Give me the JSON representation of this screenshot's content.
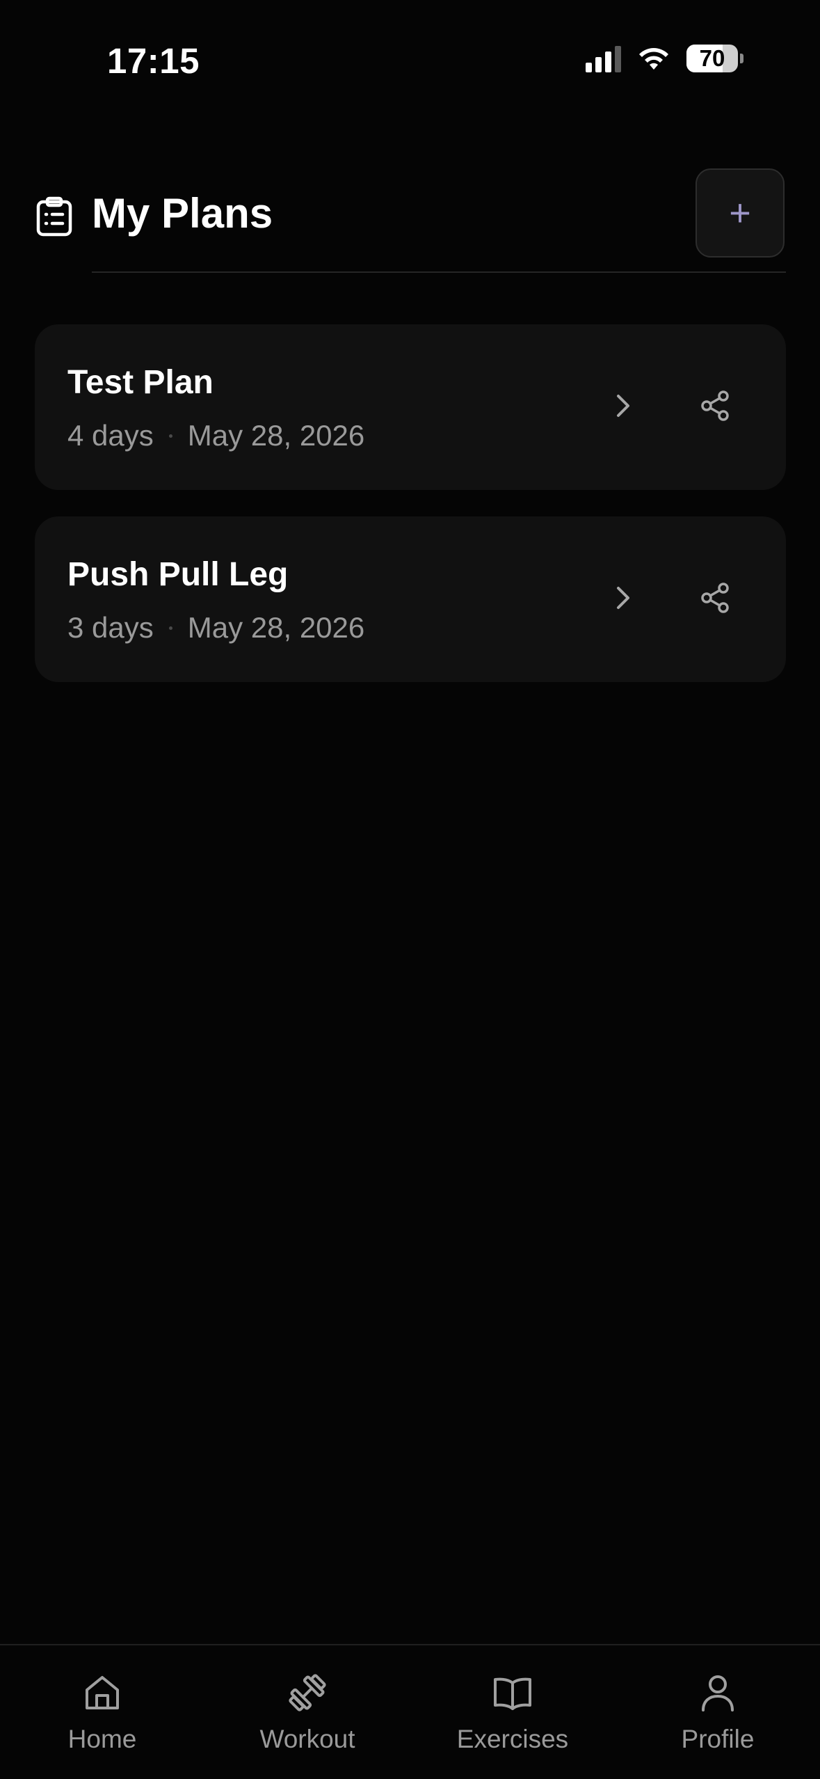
{
  "status_bar": {
    "time": "17:15",
    "battery": "70",
    "battery_level": 0.7
  },
  "header": {
    "title": "My Plans",
    "icon": "clipboard-list-icon",
    "add_icon": "plus-icon",
    "add_label": "+"
  },
  "plans": [
    {
      "name": "Test Plan",
      "days": "4 days",
      "date": "May 28, 2026"
    },
    {
      "name": "Push Pull Leg",
      "days": "3 days",
      "date": "May 28, 2026"
    }
  ],
  "nav": [
    {
      "label": "Home",
      "icon": "home-icon"
    },
    {
      "label": "Workout",
      "icon": "dumbbell-icon"
    },
    {
      "label": "Exercises",
      "icon": "book-open-icon"
    },
    {
      "label": "Profile",
      "icon": "user-icon"
    }
  ],
  "colors": {
    "background": "#050505",
    "card": "#111111",
    "muted_text": "#9a9a9a",
    "accent": "#9e97c9"
  }
}
